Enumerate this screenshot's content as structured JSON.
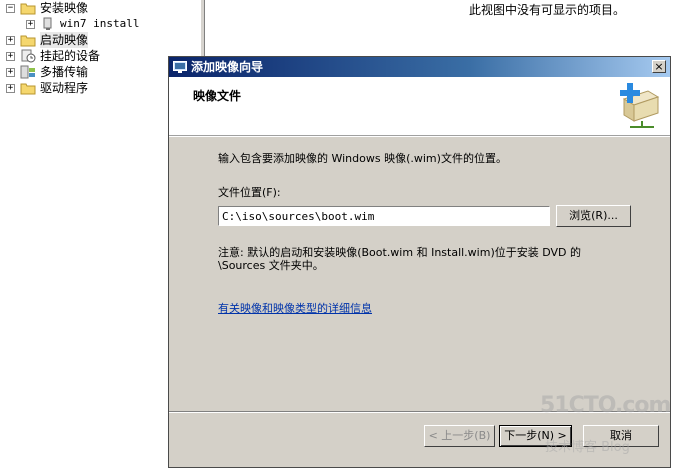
{
  "tree": {
    "items": [
      {
        "label": "安装映像",
        "expander": "−"
      },
      {
        "label": "win7 install",
        "expander": "+"
      },
      {
        "label": "启动映像",
        "expander": "+"
      },
      {
        "label": "挂起的设备",
        "expander": "+"
      },
      {
        "label": "多播传输",
        "expander": "+"
      },
      {
        "label": "驱动程序",
        "expander": "+"
      }
    ]
  },
  "list_view": {
    "empty_message": "此视图中没有可显示的项目。"
  },
  "dialog": {
    "title": "添加映像向导",
    "close_label": "×",
    "page_title": "映像文件",
    "instructions": "输入包含要添加映像的 Windows 映像(.wim)文件的位置。",
    "file_location_label": "文件位置(F):",
    "file_location_value": "C:\\iso\\sources\\boot.wim",
    "browse_label": "浏览(R)...",
    "note_line1": "注意: 默认的启动和安装映像(Boot.wim 和 Install.wim)位于安装 DVD 的",
    "note_line2": "\\Sources 文件夹中。",
    "more_info_link": "有关映像和映像类型的详细信息",
    "back_label": "< 上一步(B)",
    "next_label": "下一步(N) >",
    "cancel_label": "取消"
  },
  "watermark": {
    "main": "51CTO.com",
    "sub": "技术博客 Blog"
  },
  "colors": {
    "title_gradient_start": "#0a246a",
    "title_gradient_end": "#a6caf0",
    "dialog_bg": "#d4d0c8",
    "link": "#0033aa"
  }
}
